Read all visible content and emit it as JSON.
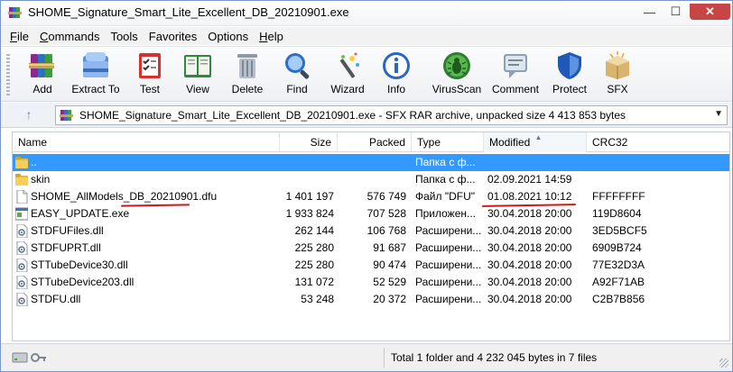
{
  "window": {
    "title": "SHOME_Signature_Smart_Lite_Excellent_DB_20210901.exe",
    "minimize_glyph": "—",
    "maximize_glyph": "☐",
    "close_glyph": "✕"
  },
  "menu": {
    "items": [
      {
        "label": "File",
        "underline": "F",
        "rest": "ile"
      },
      {
        "label": "Commands",
        "underline": "C",
        "rest": "ommands"
      },
      {
        "label": "Tools",
        "underline": "",
        "rest": "Tools"
      },
      {
        "label": "Favorites",
        "underline": "",
        "rest": "Favorites"
      },
      {
        "label": "Options",
        "underline": "",
        "rest": "Options"
      },
      {
        "label": "Help",
        "underline": "H",
        "rest": "elp"
      }
    ]
  },
  "toolbar": {
    "buttons": [
      {
        "label": "Add",
        "icon": "winrar-books-icon"
      },
      {
        "label": "Extract To",
        "icon": "extract-folder-icon"
      },
      {
        "label": "Test",
        "icon": "test-checklist-icon"
      },
      {
        "label": "View",
        "icon": "view-book-icon"
      },
      {
        "label": "Delete",
        "icon": "trash-can-icon"
      },
      {
        "label": "Find",
        "icon": "magnifier-icon"
      },
      {
        "label": "Wizard",
        "icon": "magic-wand-icon"
      },
      {
        "label": "Info",
        "icon": "info-icon"
      },
      {
        "label": "VirusScan",
        "icon": "bug-scan-icon"
      },
      {
        "label": "Comment",
        "icon": "comment-bubble-icon"
      },
      {
        "label": "Protect",
        "icon": "shield-icon"
      },
      {
        "label": "SFX",
        "icon": "sfx-box-icon"
      }
    ]
  },
  "address": {
    "text": "SHOME_Signature_Smart_Lite_Excellent_DB_20210901.exe - SFX RAR archive, unpacked size 4 413 853 bytes",
    "up_glyph": "↑",
    "drop_glyph": "▼"
  },
  "columns": {
    "name": "Name",
    "size": "Size",
    "packed": "Packed",
    "type": "Type",
    "modified": "Modified",
    "crc": "CRC32"
  },
  "files": [
    {
      "name": "..",
      "size": "",
      "packed": "",
      "type": "Папка с ф...",
      "modified": "",
      "crc": "",
      "icon": "folder-up-icon"
    },
    {
      "name": "skin",
      "size": "",
      "packed": "",
      "type": "Папка с ф...",
      "modified": "02.09.2021 14:59",
      "crc": "",
      "icon": "folder-icon"
    },
    {
      "name": "SHOME_AllModels_DB_20210901.dfu",
      "size": "1 401 197",
      "packed": "576 749",
      "type": "Файл \"DFU\"",
      "modified": "01.08.2021 10:12",
      "crc": "FFFFFFFF",
      "icon": "file-icon"
    },
    {
      "name": "EASY_UPDATE.exe",
      "size": "1 933 824",
      "packed": "707 528",
      "type": "Приложен...",
      "modified": "30.04.2018 20:00",
      "crc": "119D8604",
      "icon": "exe-icon"
    },
    {
      "name": "STDFUFiles.dll",
      "size": "262 144",
      "packed": "106 768",
      "type": "Расширени...",
      "modified": "30.04.2018 20:00",
      "crc": "3ED5BCF5",
      "icon": "dll-icon"
    },
    {
      "name": "STDFUPRT.dll",
      "size": "225 280",
      "packed": "91 687",
      "type": "Расширени...",
      "modified": "30.04.2018 20:00",
      "crc": "6909B724",
      "icon": "dll-icon"
    },
    {
      "name": "STTubeDevice30.dll",
      "size": "225 280",
      "packed": "90 474",
      "type": "Расширени...",
      "modified": "30.04.2018 20:00",
      "crc": "77E32D3A",
      "icon": "dll-icon"
    },
    {
      "name": "STTubeDevice203.dll",
      "size": "131 072",
      "packed": "52 529",
      "type": "Расширени...",
      "modified": "30.04.2018 20:00",
      "crc": "A92F71AB",
      "icon": "dll-icon"
    },
    {
      "name": "STDFU.dll",
      "size": "53 248",
      "packed": "20 372",
      "type": "Расширени...",
      "modified": "30.04.2018 20:00",
      "crc": "C2B7B856",
      "icon": "dll-icon"
    }
  ],
  "status": {
    "text": "Total 1 folder and 4 232 045 bytes in 7 files"
  },
  "colors": {
    "selection": "#3399ff",
    "annotation_red": "#d0151b"
  }
}
